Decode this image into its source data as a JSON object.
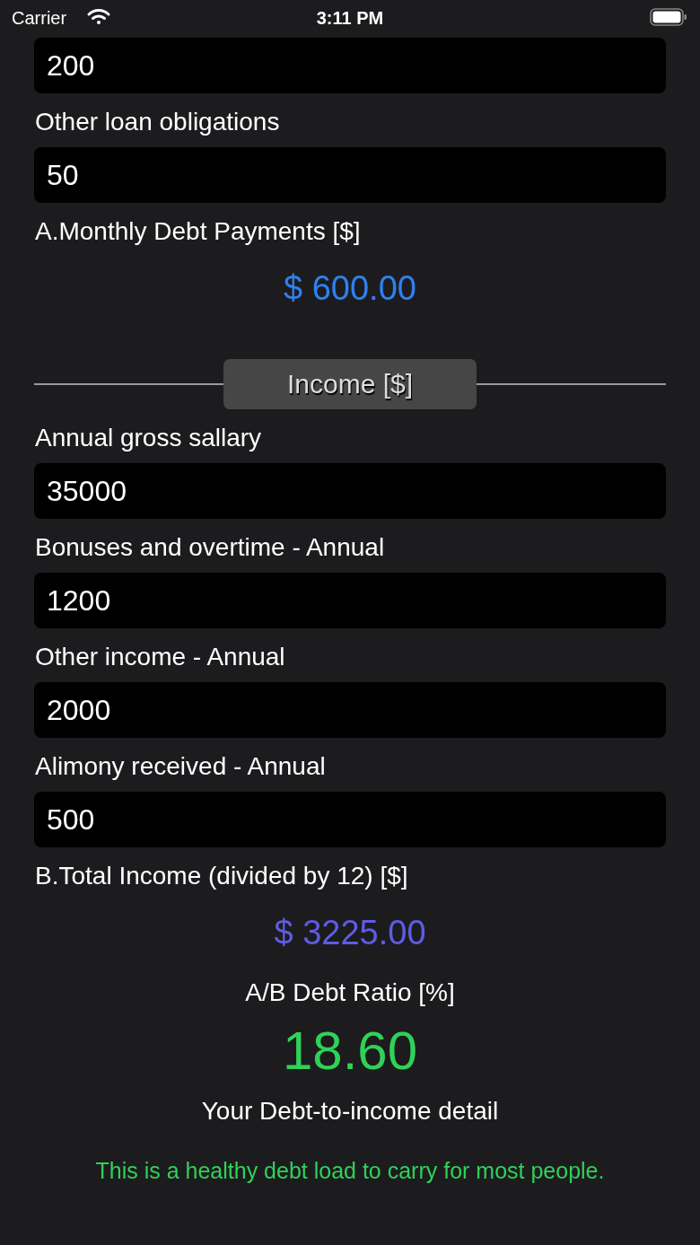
{
  "status_bar": {
    "carrier": "Carrier",
    "time": "3:11 PM"
  },
  "debt_fields": [
    {
      "value": "200"
    },
    {
      "label": "Other loan obligations",
      "value": "50"
    }
  ],
  "debt_total": {
    "label": "A.Monthly Debt Payments [$]",
    "value": "$ 600.00"
  },
  "income_section": {
    "title": "Income [$]"
  },
  "income_fields": [
    {
      "label": "Annual gross sallary",
      "value": "35000"
    },
    {
      "label": "Bonuses and overtime - Annual",
      "value": "1200"
    },
    {
      "label": "Other income - Annual",
      "value": "2000"
    },
    {
      "label": "Alimony received - Annual",
      "value": "500"
    }
  ],
  "income_total": {
    "label": "B.Total Income (divided by 12) [$]",
    "value": "$ 3225.00"
  },
  "ratio": {
    "label": "A/B Debt Ratio [%]",
    "value": "18.60"
  },
  "detail": {
    "title": "Your Debt-to-income detail",
    "message": "This is a healthy debt load to carry for most people."
  }
}
